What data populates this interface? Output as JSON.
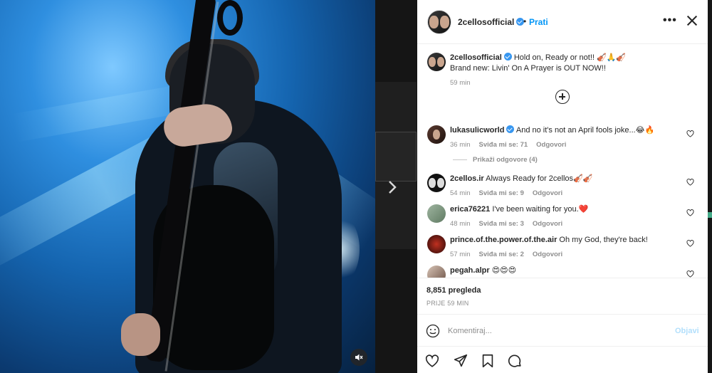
{
  "post": {
    "username": "2cellosofficial",
    "follow_label": "Prati",
    "separator": "•",
    "more_label": "•••"
  },
  "caption": {
    "username": "2cellosofficial",
    "line1": "Hold on, Ready or not!! 🎻🙏🎻",
    "line2": "Brand new: Livin' On A Prayer is OUT NOW!!",
    "time": "59 min"
  },
  "comments": [
    {
      "username": "lukasulicworld",
      "verified": true,
      "text": "And no it's not an April fools joke...😂🔥",
      "time": "36 min",
      "likes": "Sviđa mi se: 71",
      "reply": "Odgovori"
    },
    {
      "username": "2cellos.ir",
      "verified": false,
      "text": "Always Ready for 2cellos🎻🎻",
      "time": "54 min",
      "likes": "Sviđa mi se: 9",
      "reply": "Odgovori"
    },
    {
      "username": "erica76221",
      "verified": false,
      "text": "I've been waiting for you.❤️",
      "time": "48 min",
      "likes": "Sviđa mi se: 3",
      "reply": "Odgovori"
    },
    {
      "username": "prince.of.the.power.of.the.air",
      "verified": false,
      "text": "Oh my God, they're back!",
      "time": "57 min",
      "likes": "Sviđa mi se: 2",
      "reply": "Odgovori"
    },
    {
      "username": "pegah.alpr",
      "verified": false,
      "text": "😍😍😍",
      "time": "",
      "likes": "",
      "reply": ""
    }
  ],
  "view_replies": "Prikaži odgovore (4)",
  "stats": {
    "views": "8,851 pregleda",
    "ago": "PRIJE 59 MIN"
  },
  "composer": {
    "placeholder": "Komentiraj...",
    "post_label": "Objavi"
  },
  "colors": {
    "accent": "#0095f6",
    "verified": "#3897f0",
    "post_disabled": "#b2dffc"
  },
  "icons": [
    "more-icon",
    "close-icon",
    "add-icon",
    "heart-icon",
    "emoji-icon",
    "like-icon",
    "share-icon",
    "save-icon",
    "comment-icon",
    "mute-icon",
    "next-arrow-icon"
  ]
}
